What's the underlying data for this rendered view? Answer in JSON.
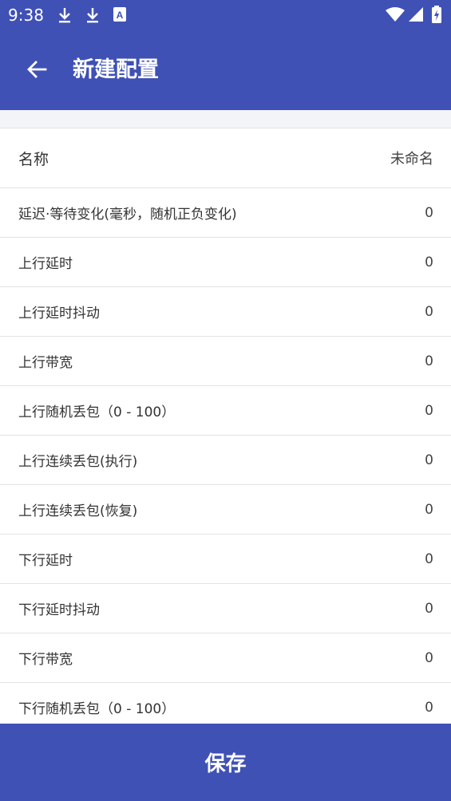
{
  "status_bar": {
    "time": "9:38",
    "icons": [
      "download-icon",
      "download-icon",
      "a-icon",
      "wifi-icon",
      "signal-icon",
      "battery-charging-icon"
    ]
  },
  "toolbar": {
    "back_icon": "arrow-back-icon",
    "title": "新建配置"
  },
  "name_row": {
    "label": "名称",
    "value": "未命名"
  },
  "rows": [
    {
      "label": "延迟·等待变化(毫秒，随机正负变化)",
      "value": "0"
    },
    {
      "label": "上行延时",
      "value": "0"
    },
    {
      "label": "上行延时抖动",
      "value": "0"
    },
    {
      "label": "上行带宽",
      "value": "0"
    },
    {
      "label": "上行随机丢包（0 - 100）",
      "value": "0"
    },
    {
      "label": "上行连续丢包(执行)",
      "value": "0"
    },
    {
      "label": "上行连续丢包(恢复)",
      "value": "0"
    },
    {
      "label": "下行延时",
      "value": "0"
    },
    {
      "label": "下行延时抖动",
      "value": "0"
    },
    {
      "label": "下行带宽",
      "value": "0"
    },
    {
      "label": "下行随机丢包（0 - 100）",
      "value": "0"
    }
  ],
  "save_button": {
    "label": "保存"
  },
  "colors": {
    "primary": "#3f51b5",
    "background": "#ffffff",
    "divider": "#e3e3e3"
  }
}
